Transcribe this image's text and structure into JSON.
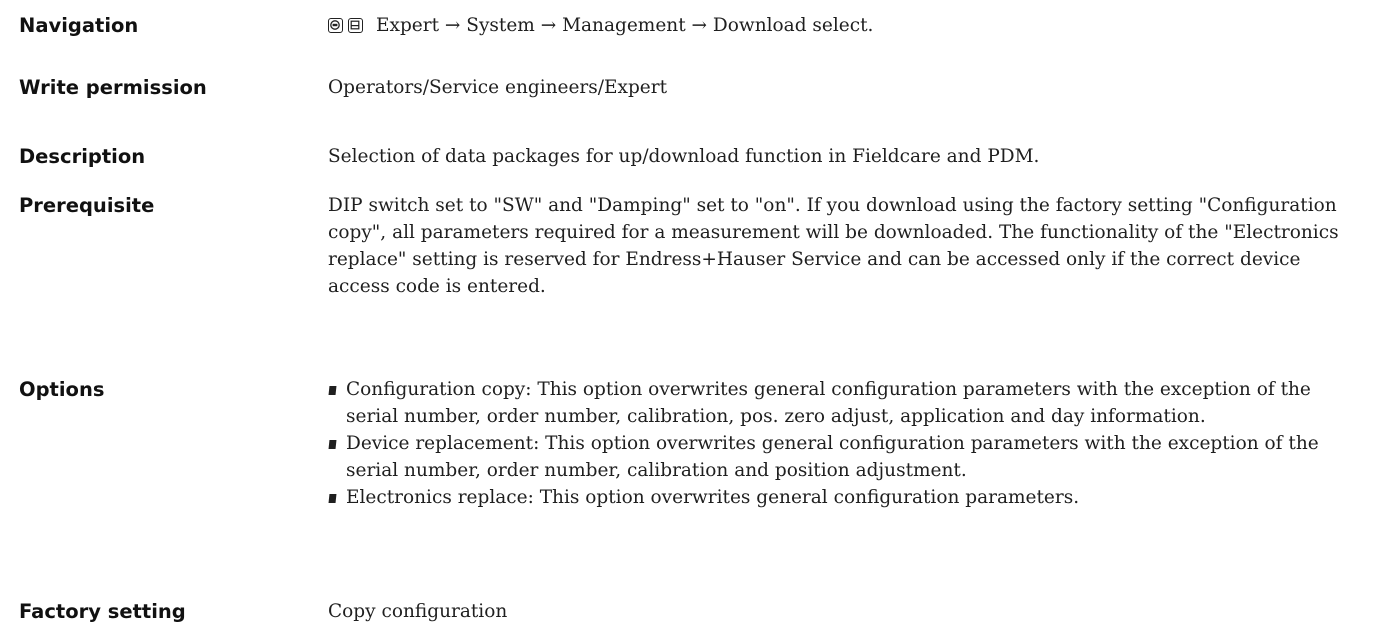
{
  "navigation": {
    "label": "Navigation",
    "icons": [
      "display-operation-icon",
      "display-menu-icon"
    ],
    "path": "Expert → System → Management → Download select."
  },
  "write_permission": {
    "label": "Write permission",
    "value": "Operators/Service engineers/Expert"
  },
  "description": {
    "label": "Description",
    "value": "Selection of data packages for up/download function in Fieldcare and PDM."
  },
  "prerequisite": {
    "label": "Prerequisite",
    "value": "DIP switch set to \"SW\" and \"Damping\" set to \"on\". If you download using the factory setting \"Configuration copy\", all parameters required for a measurement will be downloaded. The functionality of the \"Electronics replace\" setting is reserved for Endress+Hauser Service and can be accessed only if the correct device access code is entered."
  },
  "options": {
    "label": "Options",
    "items": [
      "Configuration copy: This option overwrites general configuration parameters with the exception of the serial number, order number, calibration, pos. zero adjust, application and day information.",
      "Device replacement: This option overwrites general configuration parameters with the exception of the serial number, order number, calibration and position adjustment.",
      "Electronics replace: This option overwrites general configuration parameters."
    ]
  },
  "factory_setting": {
    "label": "Factory setting",
    "value": "Copy configuration"
  }
}
